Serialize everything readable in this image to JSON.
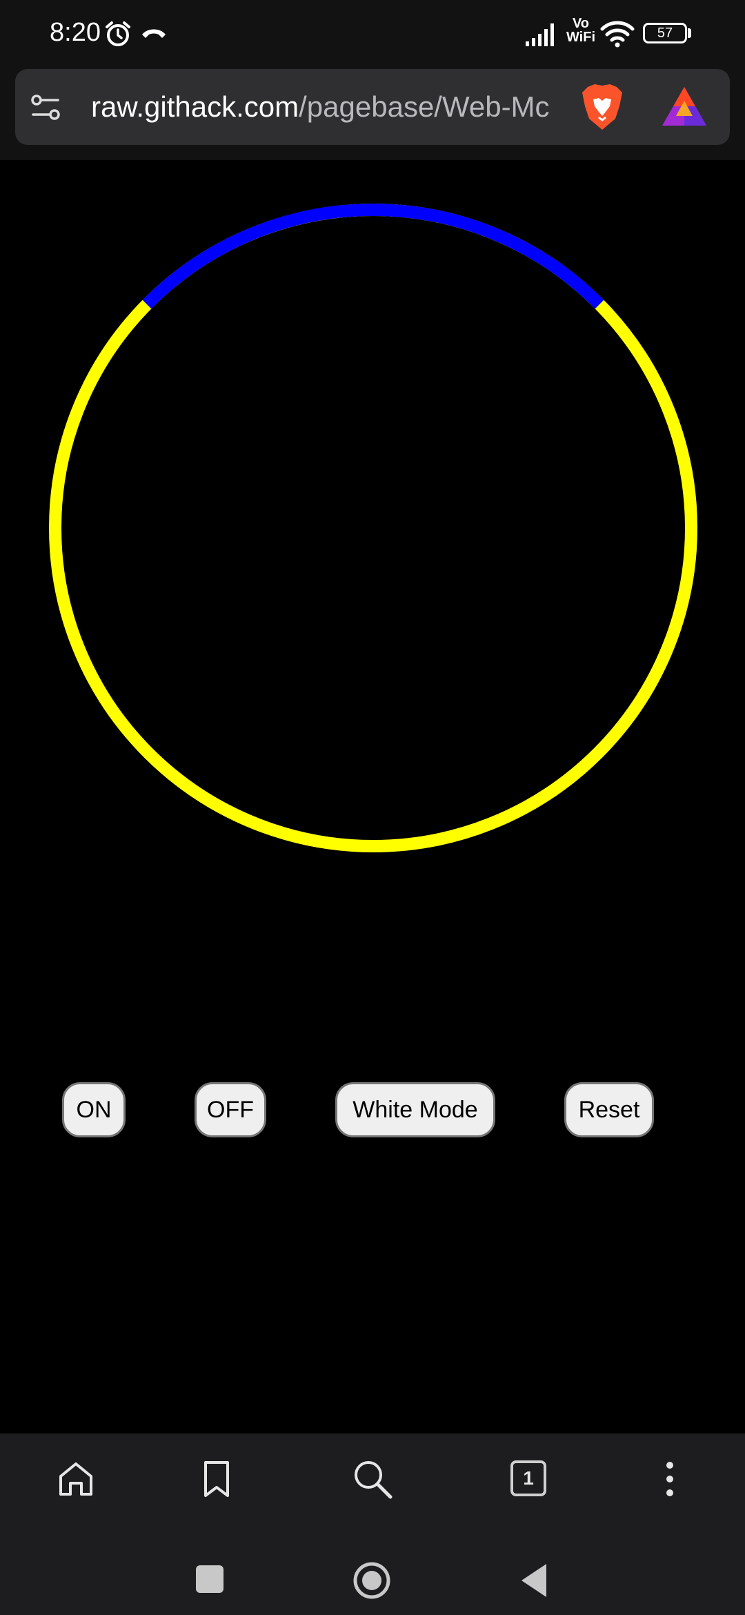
{
  "status_bar": {
    "time": "8:20",
    "network_label_top": "Vo",
    "network_label_bottom": "WiFi",
    "battery": "57",
    "icons": [
      "alarm-icon",
      "call-icon",
      "signal-icon",
      "wifi-icon",
      "battery-icon"
    ]
  },
  "browser": {
    "url_host": "raw.githack.com",
    "url_path": "/pagebase/Web-Mc",
    "tab_count": "1",
    "icons": [
      "site-settings-icon",
      "brave-shields-icon",
      "brave-rewards-icon"
    ]
  },
  "dial": {
    "colors": {
      "arc_active": "#0000ff",
      "arc_rest": "#ffff00",
      "background": "#000000"
    }
  },
  "controls": {
    "on_label": "ON",
    "off_label": "OFF",
    "white_mode_label": "White Mode",
    "reset_label": "Reset"
  },
  "toolbar": {
    "icons": [
      "home-icon",
      "bookmark-icon",
      "search-icon",
      "tabs-icon",
      "more-icon"
    ]
  },
  "system_nav": {
    "icons": [
      "recents-icon",
      "home-circle-icon",
      "back-icon"
    ]
  }
}
